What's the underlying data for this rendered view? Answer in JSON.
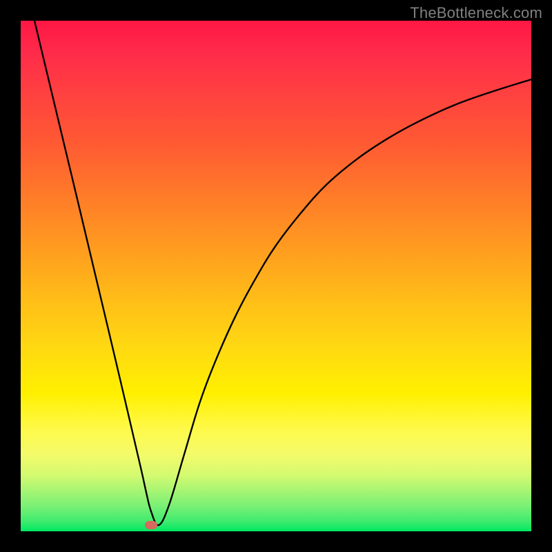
{
  "watermark": "TheBottleneck.com",
  "colors": {
    "curve_stroke": "#000000",
    "marker_fill": "#d66a5f",
    "frame_bg": "#000000"
  },
  "chart_data": {
    "type": "line",
    "title": "",
    "xlabel": "",
    "ylabel": "",
    "xlim": [
      0,
      100
    ],
    "ylim": [
      0,
      100
    ],
    "grid": false,
    "legend": false,
    "series": [
      {
        "name": "bottleneck-curve",
        "x": [
          2.7,
          5,
          8,
          11,
          14,
          17,
          20,
          23.5,
          24.5,
          25.5,
          27,
          29,
          32,
          35,
          38,
          42,
          46,
          50,
          55,
          60,
          66,
          72,
          78,
          85,
          92,
          100
        ],
        "values": [
          100,
          90.4,
          77.9,
          65.4,
          52.8,
          40.2,
          27.5,
          12.5,
          8,
          4,
          1.2,
          5,
          15,
          25,
          33,
          42,
          49.5,
          56,
          62.5,
          68,
          73,
          77,
          80.3,
          83.5,
          86,
          88.5
        ]
      }
    ],
    "annotations": [
      {
        "name": "minimum-marker",
        "x": 25.5,
        "y": 1.2,
        "shape": "pill",
        "color": "#d66a5f"
      }
    ]
  }
}
